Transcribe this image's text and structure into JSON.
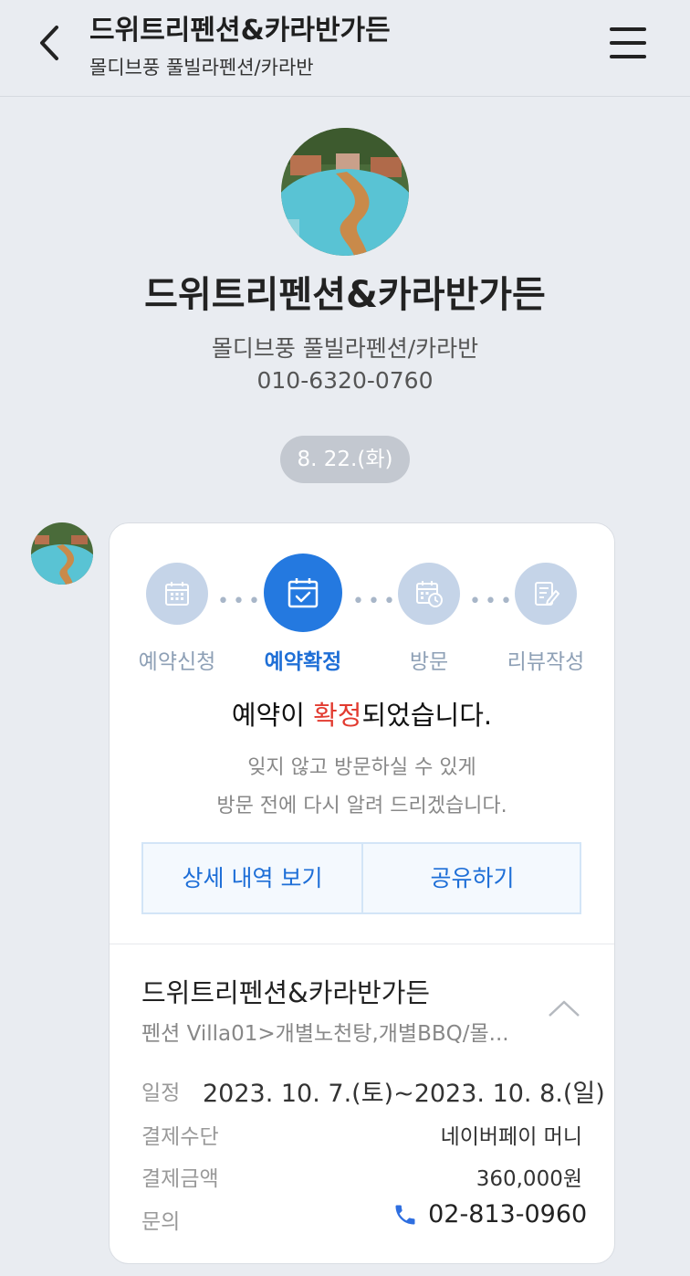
{
  "header": {
    "title": "드위트리펜션&카라반가든",
    "subtitle": "몰디브풍 풀빌라펜션/카라반"
  },
  "profile": {
    "name": "드위트리펜션&카라반가든",
    "category": "몰디브풍 풀빌라펜션/카라반",
    "phone": "010-6320-0760"
  },
  "chat": {
    "date": "8. 22.(화)"
  },
  "card": {
    "steps": [
      {
        "label": "예약신청",
        "icon": "calendar-icon",
        "active": false
      },
      {
        "label": "예약확정",
        "icon": "calendar-check-icon",
        "active": true
      },
      {
        "label": "방문",
        "icon": "calendar-clock-icon",
        "active": false
      },
      {
        "label": "리뷰작성",
        "icon": "review-write-icon",
        "active": false
      }
    ],
    "confirm_title_before": "예약이 ",
    "confirm_title_highlight": "확정",
    "confirm_title_after": "되었습니다.",
    "confirm_desc_line1": "잊지 않고 방문하실 수 있게",
    "confirm_desc_line2": "방문 전에 다시 알려 드리겠습니다.",
    "detail_button": "상세 내역 보기",
    "share_button": "공유하기",
    "shop_name": "드위트리펜션&카라반가든",
    "shop_desc": "펜션 Villa01>개별노천탕,개별BBQ/몰...",
    "schedule_label": "일정",
    "schedule_value": "2023. 10. 7.(토)~2023. 10. 8.(일)",
    "payment_method_label": "결제수단",
    "payment_method_value": "네이버페이 머니",
    "payment_amount_label": "결제금액",
    "payment_amount_value": "360,000원",
    "inquiry_label": "문의",
    "inquiry_phone": "02-813-0960"
  },
  "colors": {
    "background": "#e9ecf1",
    "accent_blue": "#2479e0",
    "highlight_red": "#e23b30",
    "inactive_step": "#c5d4e8"
  }
}
